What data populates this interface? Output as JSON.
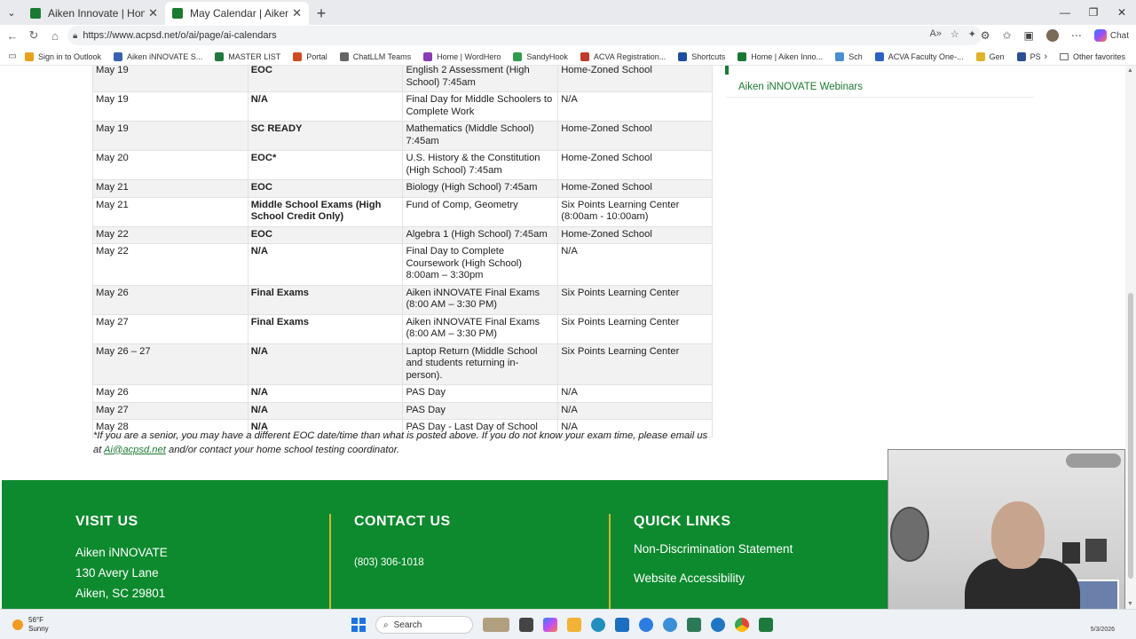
{
  "browser": {
    "tabs": [
      {
        "title": "Aiken Innovate | Home",
        "active": false
      },
      {
        "title": "May Calendar | Aiken Innovate",
        "active": true
      }
    ],
    "url": "https://www.acpsd.net/o/ai/page/ai-calendars",
    "copilot_label": "Chat",
    "bookmarks": [
      {
        "label": "Sign in to Outlook",
        "color": "#e8a21a"
      },
      {
        "label": "Aiken iNNOVATE S...",
        "color": "#3a62b3"
      },
      {
        "label": "MASTER LIST",
        "color": "#1e7a3c"
      },
      {
        "label": "Portal",
        "color": "#d14a1f"
      },
      {
        "label": "ChatLLM Teams",
        "color": "#666666"
      },
      {
        "label": "Home | WordHero",
        "color": "#8a3bb7"
      },
      {
        "label": "SandyHook",
        "color": "#2f9d4a"
      },
      {
        "label": "ACVA Registration...",
        "color": "#c23a2b"
      },
      {
        "label": "Shortcuts",
        "color": "#1d4fa0"
      },
      {
        "label": "Home | Aiken Inno...",
        "color": "#1b7a32"
      },
      {
        "label": "Sch",
        "color": "#4a8ed6"
      },
      {
        "label": "ACVA Faculty One-...",
        "color": "#2b63c4"
      },
      {
        "label": "Gen",
        "color": "#e0b324"
      },
      {
        "label": "PS",
        "color": "#2d4f96"
      }
    ],
    "other_favorites": "Other favorites"
  },
  "calendar": {
    "rows": [
      {
        "date": "May 19",
        "test": "EOC",
        "desc": "English 2 Assessment (High School) 7:45am",
        "location": "Home-Zoned School"
      },
      {
        "date": "May 19",
        "test": "N/A",
        "desc": "Final Day for Middle Schoolers to Complete Work",
        "location": "N/A"
      },
      {
        "date": "May 19",
        "test": "SC READY",
        "desc": "Mathematics (Middle School) 7:45am",
        "location": "Home-Zoned School"
      },
      {
        "date": "May 20",
        "test": "EOC*",
        "desc": "U.S. History & the Constitution (High School) 7:45am",
        "location": "Home-Zoned School"
      },
      {
        "date": "May 21",
        "test": "EOC",
        "desc": "Biology (High School) 7:45am",
        "location": "Home-Zoned School"
      },
      {
        "date": "May 21",
        "test": "Middle School Exams (High School Credit Only)",
        "desc": "Fund of Comp, Geometry",
        "location": "Six Points Learning Center (8:00am - 10:00am)"
      },
      {
        "date": "May 22",
        "test": "EOC",
        "desc": "Algebra 1 (High School) 7:45am",
        "location": "Home-Zoned School"
      },
      {
        "date": "May 22",
        "test": "N/A",
        "desc": "Final Day to Complete Coursework (High School) 8:00am – 3:30pm",
        "location": "N/A"
      },
      {
        "date": "May 26",
        "test": "Final Exams",
        "desc": "Aiken iNNOVATE Final Exams (8:00 AM – 3:30 PM)",
        "location": "Six Points Learning Center"
      },
      {
        "date": "May 27",
        "test": "Final Exams",
        "desc": "Aiken iNNOVATE Final Exams (8:00 AM – 3:30 PM)",
        "location": "Six Points Learning Center"
      },
      {
        "date": "May 26 – 27",
        "test": "N/A",
        "desc": "Laptop Return (Middle School and students returning in-person).",
        "location": "Six Points Learning Center"
      },
      {
        "date": "May 26",
        "test": "N/A",
        "desc": "PAS Day",
        "location": "N/A"
      },
      {
        "date": "May 27",
        "test": "N/A",
        "desc": "PAS Day",
        "location": "N/A"
      },
      {
        "date": "May 28",
        "test": "N/A",
        "desc": "PAS Day - Last Day of School",
        "location": "N/A"
      }
    ],
    "note_pre": "*If you are a senior, you may have a different EOC date/time than what is posted above.  If you do not know your exam time, please email us at ",
    "note_email": "Ai@acpsd.net",
    "note_post": " and/or contact your home school testing coordinator."
  },
  "sidebar": {
    "link": "Aiken iNNOVATE Webinars"
  },
  "footer": {
    "visit": {
      "heading": "VISIT US",
      "name": "Aiken iNNOVATE",
      "street": "130 Avery Lane",
      "city": "Aiken, SC 29801"
    },
    "contact": {
      "heading": "CONTACT US",
      "phone": "(803) 306-1018"
    },
    "links": {
      "heading": "QUICK LINKS",
      "items": [
        "Non-Discrimination Statement",
        "Website Accessibility"
      ]
    }
  },
  "taskbar": {
    "temp": "56°F",
    "condition": "Sunny",
    "search": "Search",
    "date": "5/3/2026"
  },
  "colors": {
    "brand_green": "#0d8a2e",
    "accent_gold": "#d9b227"
  }
}
